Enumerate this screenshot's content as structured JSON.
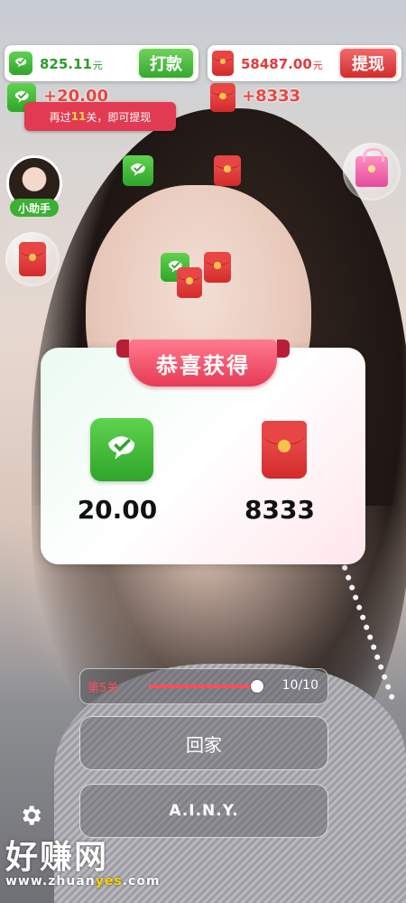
{
  "balances": {
    "wechat": {
      "amount": "825.11",
      "unit": "元",
      "button": "打款"
    },
    "redpacket": {
      "amount": "58487.00",
      "unit": "元",
      "button": "提现"
    }
  },
  "gains": {
    "wechat": "+20.00",
    "redpacket": "+8333"
  },
  "tip": {
    "prefix": "再过",
    "count": "11",
    "suffix": "关，即可提现"
  },
  "helper": {
    "label": "小助手"
  },
  "dialog": {
    "title": "恭喜获得",
    "wechat_reward": "20.00",
    "redpacket_reward": "8333"
  },
  "level": {
    "label": "第5关",
    "progress_text": "10/10",
    "progress": 1.0
  },
  "actions": {
    "home": "回家",
    "second": "A.I.N.Y."
  },
  "watermark": {
    "cn": "好赚网",
    "url_a": "www.zhuan",
    "url_b": "yes",
    "url_c": ".com"
  },
  "colors": {
    "accent_red": "#e23a52",
    "wechat_green": "#3cb033"
  }
}
